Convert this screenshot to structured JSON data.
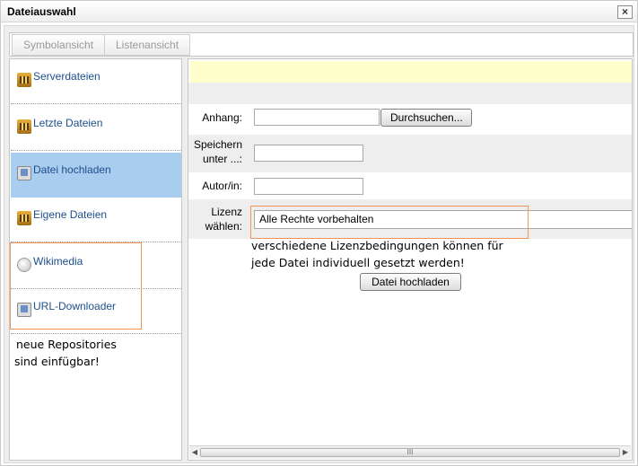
{
  "dialog": {
    "title": "Dateiauswahl",
    "close_glyph": "×"
  },
  "view_tabs": {
    "symbol": "Symbolansicht",
    "list": "Listenansicht"
  },
  "sidebar": {
    "items": [
      {
        "label": "Serverdateien",
        "icon": "repository-icon",
        "active": false
      },
      {
        "label": "Letzte Dateien",
        "icon": "repository-icon",
        "active": false
      },
      {
        "label": "Datei hochladen",
        "icon": "upload-icon",
        "active": true
      },
      {
        "label": "Eigene Dateien",
        "icon": "repository-icon",
        "active": false
      },
      {
        "label": "Wikimedia",
        "icon": "wikimedia-icon",
        "active": false
      },
      {
        "label": "URL-Downloader",
        "icon": "url-downloader-icon",
        "active": false
      }
    ]
  },
  "annotations": {
    "repos_line1": "neue Repositories",
    "repos_line2": "sind einfügbar!",
    "license_line1": "verschiedene Lizenzbedingungen können für",
    "license_line2": "jede Datei individuell gesetzt werden!"
  },
  "upload_form": {
    "attachment_label": "Anhang:",
    "browse_button": "Durchsuchen...",
    "save_as_label_line1": "Speichern",
    "save_as_label_line2": "unter ...:",
    "author_label": "Autor/in:",
    "license_label_line1": "Lizenz",
    "license_label_line2": "wählen:",
    "license_value": "Alle Rechte vorbehalten",
    "upload_button": "Datei hochladen",
    "attachment_value": "",
    "save_as_value": "",
    "author_value": ""
  },
  "scrollbar": {
    "left_arrow": "◀",
    "right_arrow": "▶",
    "grip": "III"
  },
  "colors": {
    "accent_active": "#a9cdee",
    "link_blue": "#1d4f8c",
    "highlight_orange": "#f29657",
    "message_yellow": "#ffffcc"
  }
}
